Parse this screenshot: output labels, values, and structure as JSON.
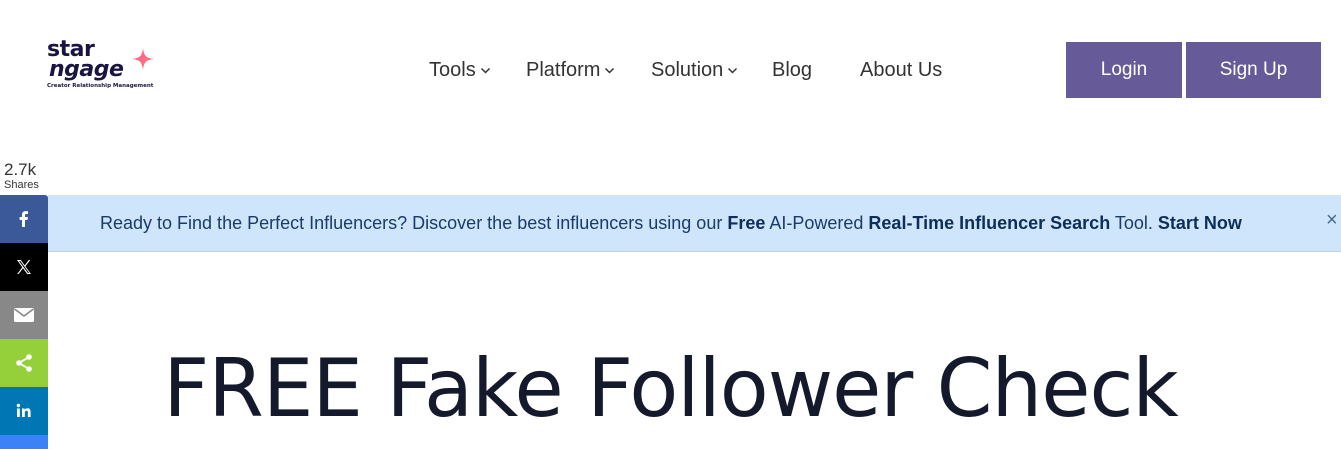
{
  "logo": {
    "line1": "star",
    "line2": "ngage",
    "tagline": "Creator Relationship Management"
  },
  "nav": {
    "tools": "Tools",
    "platform": "Platform",
    "solution": "Solution",
    "blog": "Blog",
    "about": "About Us"
  },
  "auth": {
    "login": "Login",
    "signup": "Sign Up"
  },
  "share": {
    "count": "2.7k",
    "label": "Shares"
  },
  "banner": {
    "text1": "Ready to Find the Perfect Influencers? Discover the best influencers using our ",
    "free": "Free",
    "text2": " AI-Powered ",
    "search": "Real-Time Influencer Search",
    "text3": " Tool. ",
    "cta": "Start Now",
    "close": "×"
  },
  "hero": {
    "title": "FREE Fake Follower Check"
  },
  "colors": {
    "accent": "#675a98",
    "banner_bg": "#cfe5fb"
  }
}
